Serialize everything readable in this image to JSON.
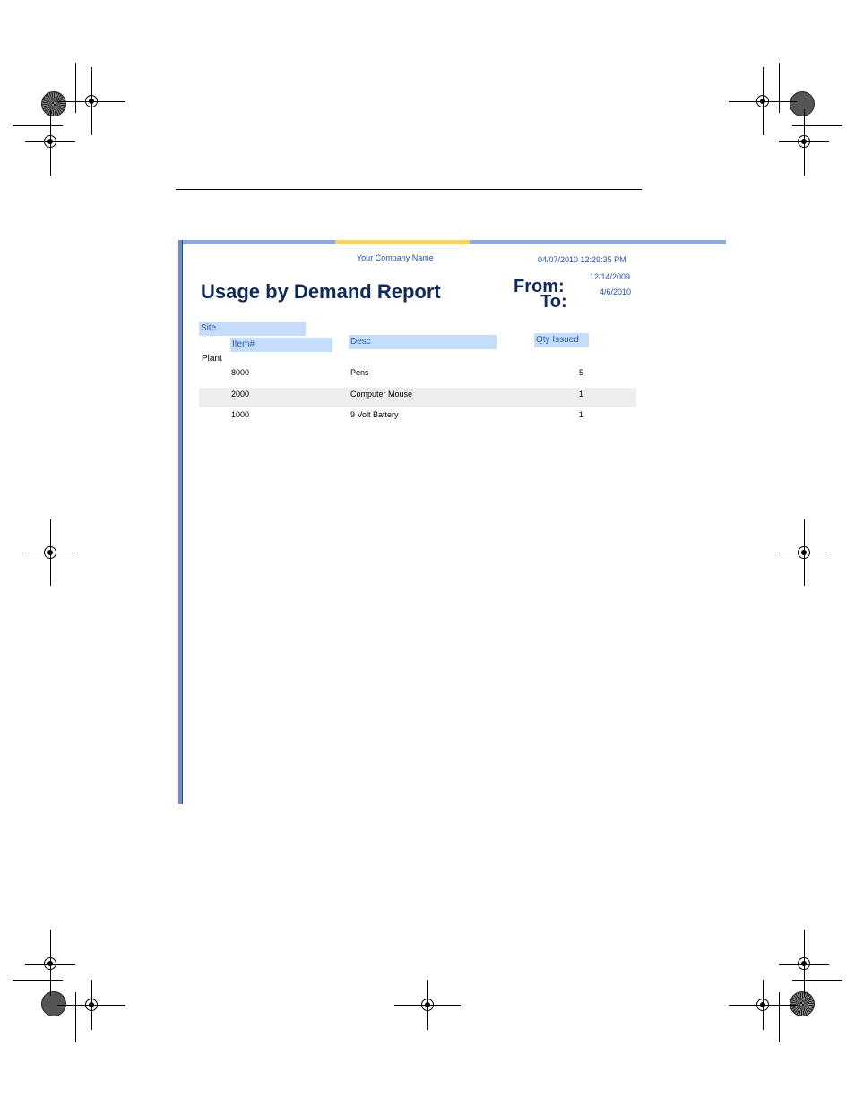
{
  "report": {
    "company_name": "Your Company Name",
    "timestamp": "04/07/2010 12:29:35 PM",
    "title": "Usage by Demand Report",
    "from_label": "From:",
    "to_label": "To:",
    "from_date": "12/14/2009",
    "to_date": "4/6/2010",
    "columns": {
      "site": "Site",
      "item": "Item#",
      "desc": "Desc",
      "qty": "Qty Issued"
    },
    "group_label": "Plant",
    "rows": [
      {
        "item": "8000",
        "desc": "Pens",
        "qty": "5"
      },
      {
        "item": "2000",
        "desc": "Computer Mouse",
        "qty": "1"
      },
      {
        "item": "1000",
        "desc": "9 Volt Battery",
        "qty": "1"
      }
    ]
  },
  "colors": {
    "header_fill": "#c6dcfb",
    "alt_row_fill": "#eeeeee",
    "title_color": "#0f2a5c",
    "frame_blue": "#8eaadb",
    "frame_gold": "#f5d169"
  }
}
